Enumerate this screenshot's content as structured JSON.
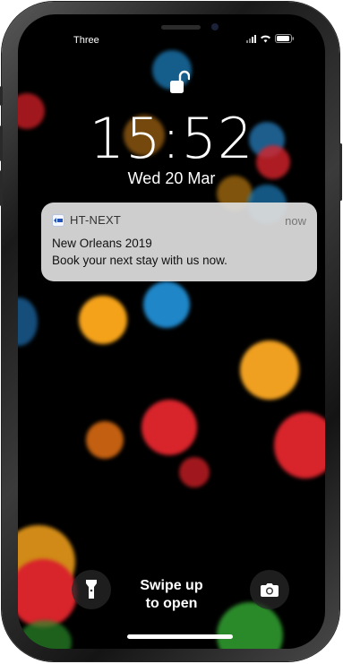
{
  "status_bar": {
    "carrier": "Three",
    "signal_icon": "cellular-signal-icon",
    "wifi_icon": "wifi-icon",
    "battery_icon": "battery-icon"
  },
  "lock_screen": {
    "lock_icon": "unlocked-padlock-icon",
    "time": "15:52",
    "date": "Wed 20 Mar"
  },
  "notification": {
    "app_icon": "ht-next-app-icon",
    "app_name": "HT-NEXT",
    "timestamp": "now",
    "title": "New Orleans 2019",
    "body": "Book your next stay with us now."
  },
  "bottom_controls": {
    "flashlight_icon": "flashlight-icon",
    "camera_icon": "camera-icon",
    "swipe_line1": "Swipe up",
    "swipe_line2": "to open"
  },
  "colors": {
    "wallpaper_background": "#000000",
    "notification_background": "#dedede",
    "bokeh_red": "#d8242b",
    "bokeh_orange": "#f4a21a",
    "bokeh_blue": "#1f86c8",
    "bokeh_green": "#2a8a2a"
  }
}
